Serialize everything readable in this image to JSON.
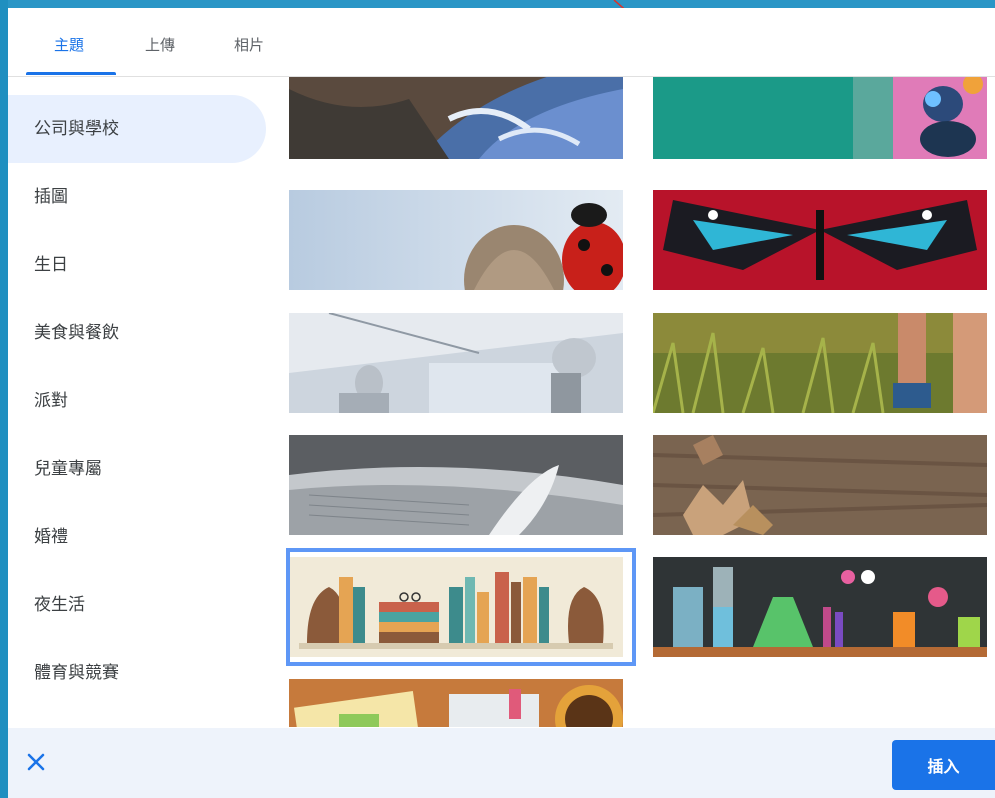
{
  "tabs": [
    {
      "label": "主題",
      "active": true
    },
    {
      "label": "上傳",
      "active": false
    },
    {
      "label": "相片",
      "active": false
    }
  ],
  "sidebar": {
    "items": [
      {
        "label": "公司與學校",
        "active": true
      },
      {
        "label": "插圖",
        "active": false
      },
      {
        "label": "生日",
        "active": false
      },
      {
        "label": "美食與餐飲",
        "active": false
      },
      {
        "label": "派對",
        "active": false
      },
      {
        "label": "兒童專屬",
        "active": false
      },
      {
        "label": "婚禮",
        "active": false
      },
      {
        "label": "夜生活",
        "active": false
      },
      {
        "label": "體育與競賽",
        "active": false
      }
    ]
  },
  "gallery": {
    "images": [
      {
        "icon": "earth-from-space-image"
      },
      {
        "icon": "teal-insect-macro-image"
      },
      {
        "icon": "ladybug-seed-image"
      },
      {
        "icon": "blue-butterfly-image"
      },
      {
        "icon": "robots-room-image"
      },
      {
        "icon": "grass-runner-image"
      },
      {
        "icon": "open-book-feather-image"
      },
      {
        "icon": "leaves-on-wood-image"
      },
      {
        "icon": "bookshelf-illustration-image",
        "selected": true
      },
      {
        "icon": "chemistry-lab-image"
      },
      {
        "icon": "desk-notes-coffee-image"
      }
    ]
  },
  "footer": {
    "close_icon": "close-icon",
    "insert_label": "插入"
  },
  "colors": {
    "accent": "#1a73e8",
    "selected_border": "#5e97f6",
    "sidebar_active_bg": "#e8f0fe",
    "footer_bg": "#eef3fb"
  }
}
